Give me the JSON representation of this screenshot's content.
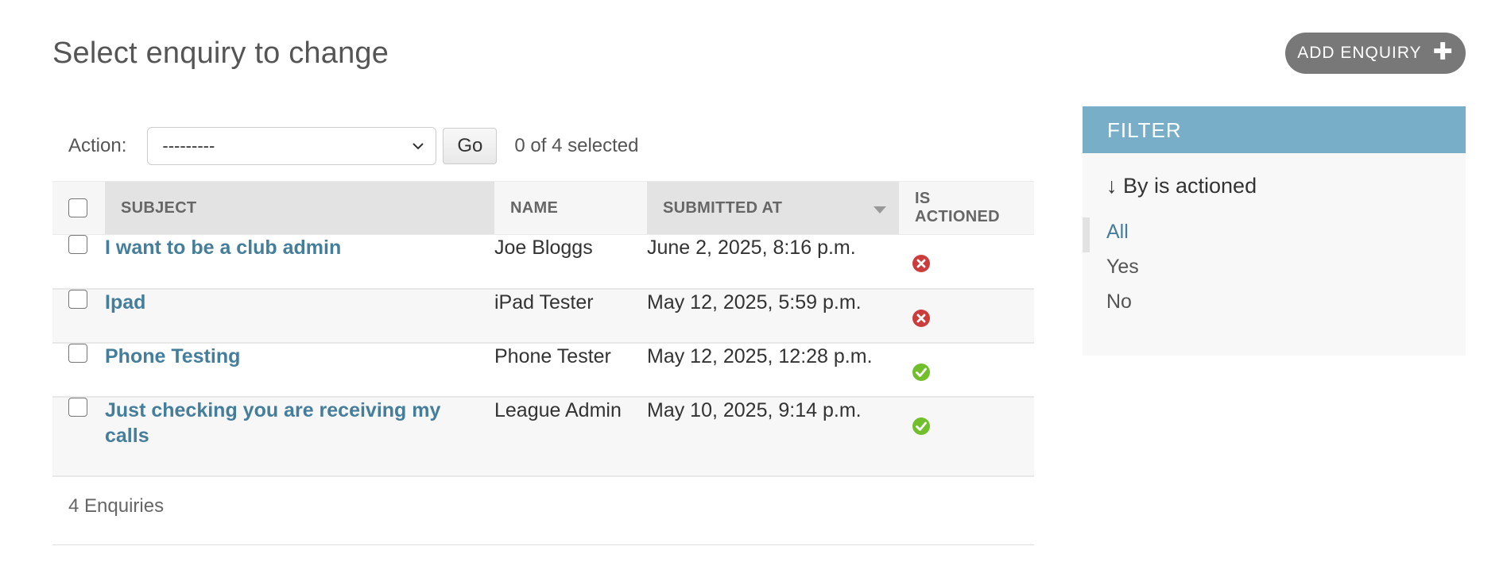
{
  "page": {
    "title": "Select enquiry to change",
    "add_button_label": "ADD ENQUIRY",
    "add_button_icon": "plus-icon"
  },
  "actions": {
    "label": "Action:",
    "select_value": "---------",
    "go_label": "Go",
    "selected_text": "0 of 4 selected"
  },
  "table": {
    "columns": [
      "SUBJECT",
      "NAME",
      "SUBMITTED AT",
      "IS ACTIONED"
    ],
    "sorted_column": "SUBMITTED AT",
    "rows": [
      {
        "subject": "I want to be a club admin",
        "name": "Joe Bloggs",
        "submitted_at": "June 2, 2025, 8:16 p.m.",
        "is_actioned": false
      },
      {
        "subject": "Ipad",
        "name": "iPad Tester",
        "submitted_at": "May 12, 2025, 5:59 p.m.",
        "is_actioned": false
      },
      {
        "subject": "Phone Testing",
        "name": "Phone Tester",
        "submitted_at": "May 12, 2025, 12:28 p.m.",
        "is_actioned": true
      },
      {
        "subject": "Just checking you are receiving my calls",
        "name": "League Admin",
        "submitted_at": "May 10, 2025, 9:14 p.m.",
        "is_actioned": true
      }
    ],
    "footer_count": "4 Enquiries"
  },
  "filter": {
    "header": "FILTER",
    "subtitle": "↓ By is actioned",
    "options": [
      "All",
      "Yes",
      "No"
    ],
    "selected": "All"
  },
  "colors": {
    "link": "#447e9b",
    "filter_header": "#79aec8",
    "add_button": "#787878",
    "no_icon": "#cc3c3c",
    "yes_icon": "#70bf2b"
  }
}
